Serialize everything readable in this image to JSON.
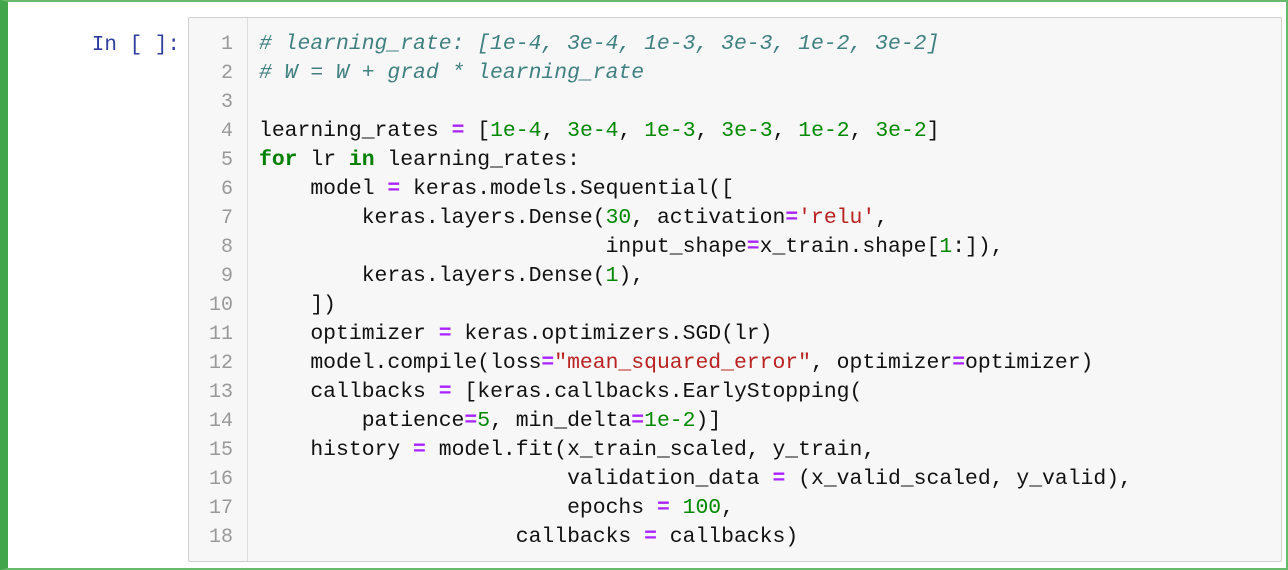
{
  "cell": {
    "prompt": "In [ ]:",
    "line_numbers": [
      "1",
      "2",
      "3",
      "4",
      "5",
      "6",
      "7",
      "8",
      "9",
      "10",
      "11",
      "12",
      "13",
      "14",
      "15",
      "16",
      "17",
      "18"
    ],
    "code_lines": [
      [
        {
          "t": "comment",
          "s": "# learning_rate: [1e-4, 3e-4, 1e-3, 3e-3, 1e-2, 3e-2]"
        }
      ],
      [
        {
          "t": "comment",
          "s": "# W = W + grad * learning_rate"
        }
      ],
      [],
      [
        {
          "t": "plain",
          "s": "learning_rates "
        },
        {
          "t": "op",
          "s": "="
        },
        {
          "t": "plain",
          "s": " ["
        },
        {
          "t": "number",
          "s": "1e-4"
        },
        {
          "t": "plain",
          "s": ", "
        },
        {
          "t": "number",
          "s": "3e-4"
        },
        {
          "t": "plain",
          "s": ", "
        },
        {
          "t": "number",
          "s": "1e-3"
        },
        {
          "t": "plain",
          "s": ", "
        },
        {
          "t": "number",
          "s": "3e-3"
        },
        {
          "t": "plain",
          "s": ", "
        },
        {
          "t": "number",
          "s": "1e-2"
        },
        {
          "t": "plain",
          "s": ", "
        },
        {
          "t": "number",
          "s": "3e-2"
        },
        {
          "t": "plain",
          "s": "]"
        }
      ],
      [
        {
          "t": "keyword",
          "s": "for"
        },
        {
          "t": "plain",
          "s": " lr "
        },
        {
          "t": "keyword",
          "s": "in"
        },
        {
          "t": "plain",
          "s": " learning_rates:"
        }
      ],
      [
        {
          "t": "plain",
          "s": "    model "
        },
        {
          "t": "op",
          "s": "="
        },
        {
          "t": "plain",
          "s": " keras.models.Sequential(["
        }
      ],
      [
        {
          "t": "plain",
          "s": "        keras.layers.Dense("
        },
        {
          "t": "number",
          "s": "30"
        },
        {
          "t": "plain",
          "s": ", activation"
        },
        {
          "t": "op",
          "s": "="
        },
        {
          "t": "string",
          "s": "'relu'"
        },
        {
          "t": "plain",
          "s": ","
        }
      ],
      [
        {
          "t": "plain",
          "s": "                           input_shape"
        },
        {
          "t": "op",
          "s": "="
        },
        {
          "t": "plain",
          "s": "x_train.shape["
        },
        {
          "t": "number",
          "s": "1"
        },
        {
          "t": "plain",
          "s": ":]),"
        }
      ],
      [
        {
          "t": "plain",
          "s": "        keras.layers.Dense("
        },
        {
          "t": "number",
          "s": "1"
        },
        {
          "t": "plain",
          "s": "),"
        }
      ],
      [
        {
          "t": "plain",
          "s": "    ])"
        }
      ],
      [
        {
          "t": "plain",
          "s": "    optimizer "
        },
        {
          "t": "op",
          "s": "="
        },
        {
          "t": "plain",
          "s": " keras.optimizers.SGD(lr)"
        }
      ],
      [
        {
          "t": "plain",
          "s": "    model.compile(loss"
        },
        {
          "t": "op",
          "s": "="
        },
        {
          "t": "string",
          "s": "\"mean_squared_error\""
        },
        {
          "t": "plain",
          "s": ", optimizer"
        },
        {
          "t": "op",
          "s": "="
        },
        {
          "t": "plain",
          "s": "optimizer)"
        }
      ],
      [
        {
          "t": "plain",
          "s": "    callbacks "
        },
        {
          "t": "op",
          "s": "="
        },
        {
          "t": "plain",
          "s": " [keras.callbacks.EarlyStopping("
        }
      ],
      [
        {
          "t": "plain",
          "s": "        patience"
        },
        {
          "t": "op",
          "s": "="
        },
        {
          "t": "number",
          "s": "5"
        },
        {
          "t": "plain",
          "s": ", min_delta"
        },
        {
          "t": "op",
          "s": "="
        },
        {
          "t": "number",
          "s": "1e-2"
        },
        {
          "t": "plain",
          "s": ")]"
        }
      ],
      [
        {
          "t": "plain",
          "s": "    history "
        },
        {
          "t": "op",
          "s": "="
        },
        {
          "t": "plain",
          "s": " model.fit(x_train_scaled, y_train,"
        }
      ],
      [
        {
          "t": "plain",
          "s": "                        validation_data "
        },
        {
          "t": "op",
          "s": "="
        },
        {
          "t": "plain",
          "s": " (x_valid_scaled, y_valid),"
        }
      ],
      [
        {
          "t": "plain",
          "s": "                        epochs "
        },
        {
          "t": "op",
          "s": "="
        },
        {
          "t": "plain",
          "s": " "
        },
        {
          "t": "number",
          "s": "100"
        },
        {
          "t": "plain",
          "s": ","
        }
      ],
      [
        {
          "t": "plain",
          "s": "                    callbacks "
        },
        {
          "t": "op",
          "s": "="
        },
        {
          "t": "plain",
          "s": " callbacks)"
        }
      ]
    ]
  },
  "colors": {
    "cell_border_selected": "#42a54b",
    "prompt": "#303f9f",
    "comment": "#408080",
    "keyword": "#008000",
    "number": "#008800",
    "string": "#ba2121",
    "operator": "#aa22ff"
  }
}
